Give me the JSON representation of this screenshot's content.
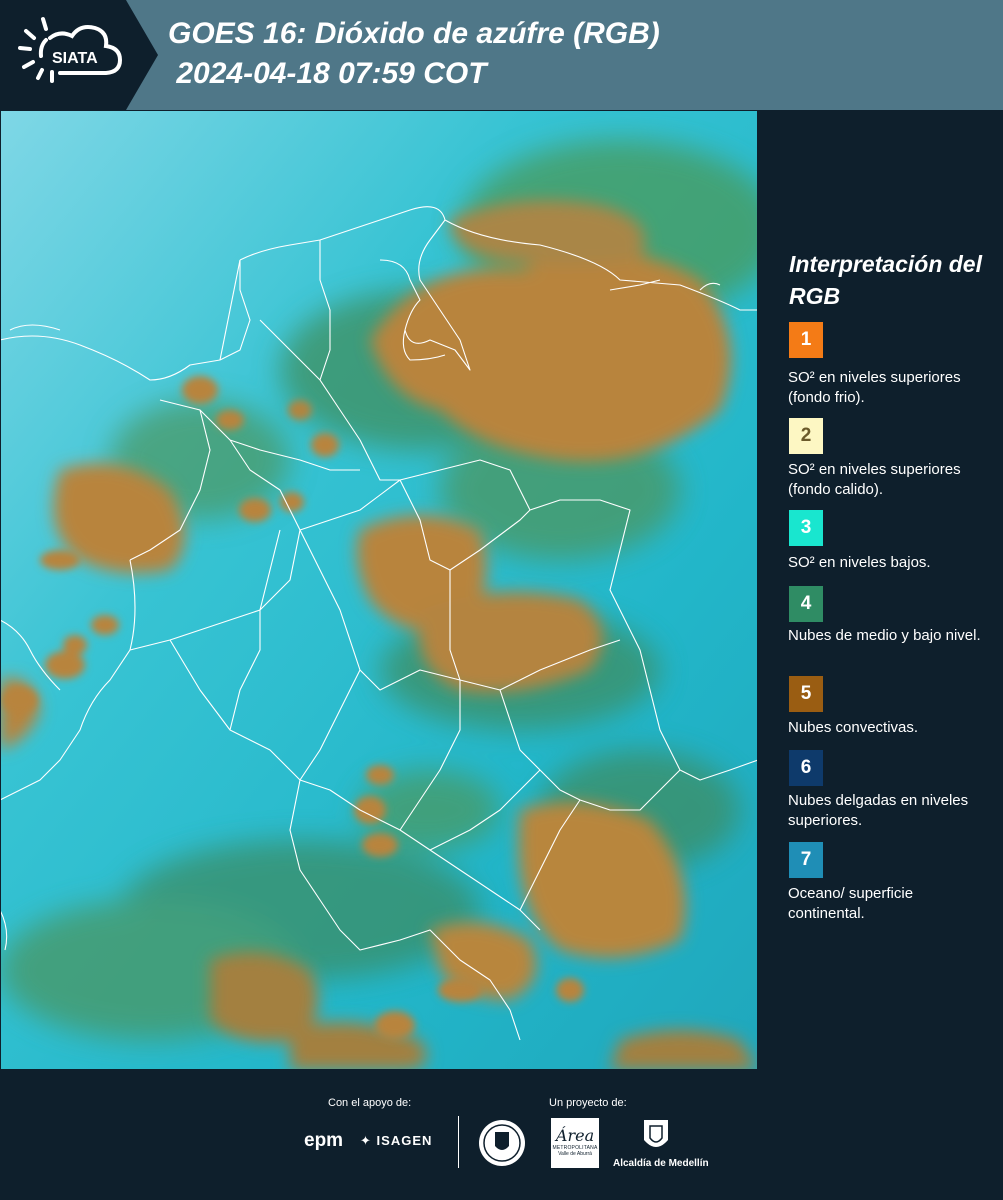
{
  "header": {
    "logo_text": "SIATA",
    "title_line1": "GOES 16: Dióxido de azúfre (RGB)",
    "title_line2": " 2024-04-18 07:59 COT"
  },
  "legend": {
    "title": "Interpretación del RGB",
    "items": [
      {
        "num": "1",
        "color": "#f47b16",
        "text": "SO² en niveles superiores (fondo frio)."
      },
      {
        "num": "2",
        "color": "#fdf7c3",
        "text": "SO² en niveles superiores (fondo calido)."
      },
      {
        "num": "3",
        "color": "#19e6cf",
        "text": "SO² en niveles bajos."
      },
      {
        "num": "4",
        "color": "#2f8c64",
        "text": "Nubes de medio y bajo nivel."
      },
      {
        "num": "5",
        "color": "#9a5d12",
        "text": "Nubes convectivas."
      },
      {
        "num": "6",
        "color": "#0e3a6b",
        "text": "Nubes delgadas en niveles superiores."
      },
      {
        "num": "7",
        "color": "#1f8eb6",
        "text": "Oceano/ superficie continental."
      }
    ]
  },
  "footer": {
    "support_label": "Con el apoyo de:",
    "project_label": "Un proyecto de:",
    "epm": "epm",
    "isagen": "ISAGEN",
    "area_main": "Área",
    "area_sub1": "METROPOLITANA",
    "area_sub2": "Valle de Aburrá",
    "alcaldia": "Alcaldía de Medellín"
  },
  "colors": {
    "header_bg": "#4f7788",
    "panel_bg": "#0e1f2c",
    "cloud_orange": "#b8863c",
    "sea_cyan": "#2fc0cf"
  }
}
